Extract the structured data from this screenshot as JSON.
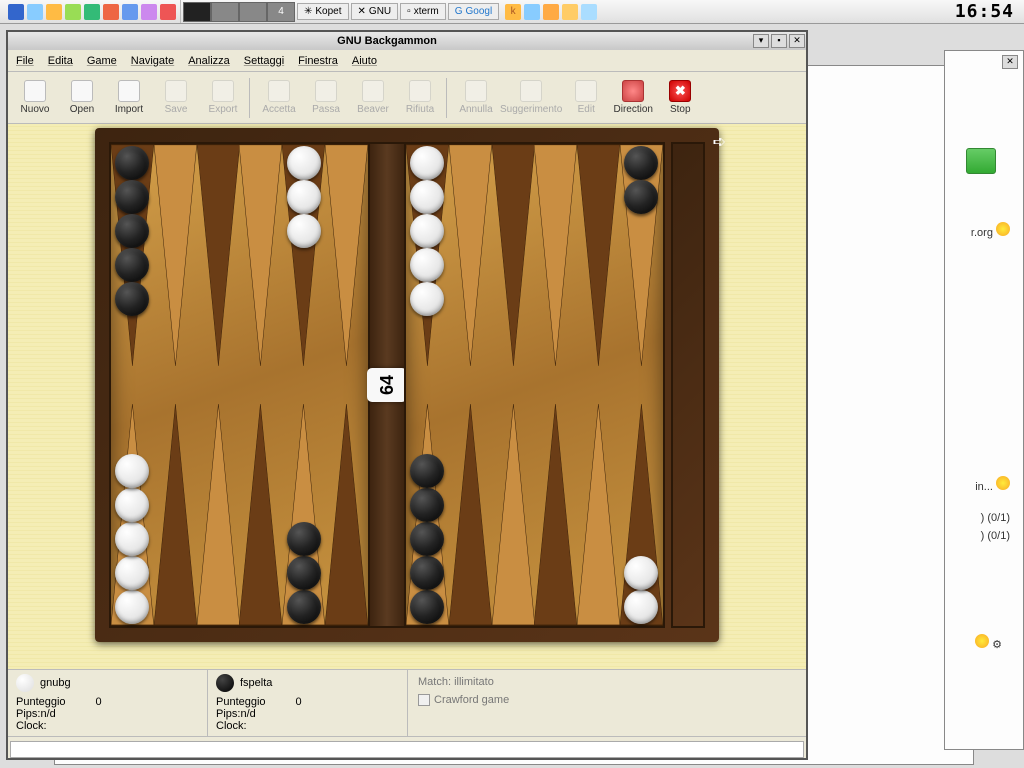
{
  "taskbar": {
    "buttons": [
      "Kopet",
      "GNU",
      "xterm",
      "Googl"
    ],
    "pager": [
      "",
      "",
      "",
      "4"
    ],
    "clock": "16:54",
    "tray_k": "k"
  },
  "window": {
    "title": "GNU Backgammon"
  },
  "menu": [
    "File",
    "Edita",
    "Game",
    "Navigate",
    "Analizza",
    "Settaggi",
    "Finestra",
    "Aiuto"
  ],
  "tools": [
    {
      "label": "Nuovo",
      "enabled": true
    },
    {
      "label": "Open",
      "enabled": true
    },
    {
      "label": "Import",
      "enabled": true
    },
    {
      "label": "Save",
      "enabled": false
    },
    {
      "label": "Export",
      "enabled": false
    },
    {
      "sep": true
    },
    {
      "label": "Accetta",
      "enabled": false
    },
    {
      "label": "Passa",
      "enabled": false
    },
    {
      "label": "Beaver",
      "enabled": false
    },
    {
      "label": "Rifiuta",
      "enabled": false
    },
    {
      "sep": true
    },
    {
      "label": "Annulla",
      "enabled": false
    },
    {
      "label": "Suggerimento",
      "enabled": false
    },
    {
      "label": "Edit",
      "enabled": false
    },
    {
      "label": "Direction",
      "enabled": true,
      "icon": "dir"
    },
    {
      "label": "Stop",
      "enabled": true,
      "icon": "stop",
      "glyph": "✖"
    }
  ],
  "cube": "64",
  "board": {
    "comment": "points indexed 0..11 per half, top row descends from bar outward, bottom ascends",
    "left": {
      "top": [
        {
          "c": "b",
          "n": 5
        },
        null,
        null,
        null,
        {
          "c": "w",
          "n": 3
        },
        null
      ],
      "bottom": [
        {
          "c": "w",
          "n": 5
        },
        null,
        null,
        null,
        {
          "c": "b",
          "n": 3
        },
        null
      ]
    },
    "right": {
      "top": [
        {
          "c": "w",
          "n": 5
        },
        null,
        null,
        null,
        null,
        {
          "c": "b",
          "n": 2
        }
      ],
      "bottom": [
        {
          "c": "b",
          "n": 5
        },
        null,
        null,
        null,
        null,
        {
          "c": "w",
          "n": 2
        }
      ]
    }
  },
  "players": {
    "p1": {
      "name": "gnubg",
      "color": "w",
      "score_label": "Punteggio",
      "score": "0",
      "pips_label": "Pips:",
      "pips": "n/d",
      "clock_label": "Clock:"
    },
    "p2": {
      "name": "fspelta",
      "color": "b",
      "score_label": "Punteggio",
      "score": "0",
      "pips_label": "Pips:",
      "pips": "n/d",
      "clock_label": "Clock:"
    }
  },
  "match": {
    "label": "Match:",
    "value": "illimitato",
    "crawford": "Crawford game"
  },
  "side_bits": {
    "org": "r.org",
    "in": "in...",
    "r1": ") (0/1)",
    "r2": ") (0/1)"
  }
}
